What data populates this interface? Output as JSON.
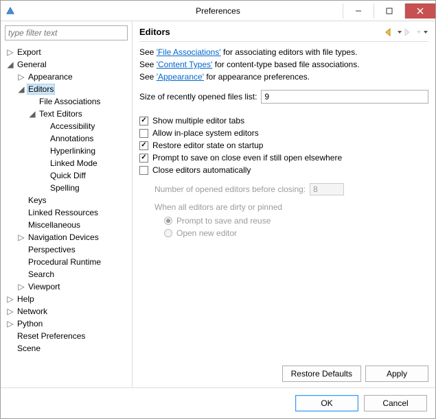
{
  "window": {
    "title": "Preferences"
  },
  "filter": {
    "placeholder": "type filter text"
  },
  "tree": {
    "export": "Export",
    "general": "General",
    "appearance": "Appearance",
    "editors": "Editors",
    "file_associations": "File Associations",
    "text_editors": "Text Editors",
    "accessibility": "Accessibility",
    "annotations": "Annotations",
    "hyperlinking": "Hyperlinking",
    "linked_mode": "Linked Mode",
    "quick_diff": "Quick Diff",
    "spelling": "Spelling",
    "keys": "Keys",
    "linked_ressources": "Linked Ressources",
    "miscellaneous": "Miscellaneous",
    "navigation_devices": "Navigation Devices",
    "perspectives": "Perspectives",
    "procedural_runtime": "Procedural Runtime",
    "search": "Search",
    "viewport": "Viewport",
    "help": "Help",
    "network": "Network",
    "python": "Python",
    "reset_preferences": "Reset Preferences",
    "scene": "Scene"
  },
  "page": {
    "title": "Editors",
    "line1_pre": "See ",
    "link1": "'File Associations'",
    "line1_post": " for associating editors with file types.",
    "line2_pre": "See ",
    "link2": "'Content Types'",
    "line2_post": " for content-type based file associations.",
    "line3_pre": "See ",
    "link3": "'Appearance'",
    "line3_post": " for appearance preferences.",
    "size_label": "Size of recently opened files list:",
    "size_value": "9",
    "chk1": "Show multiple editor tabs",
    "chk2": "Allow in-place system editors",
    "chk3": "Restore editor state on startup",
    "chk4": "Prompt to save on close even if still open elsewhere",
    "chk5": "Close editors automatically",
    "num_label": "Number of opened editors before closing:",
    "num_value": "8",
    "group_label": "When all editors are dirty or pinned",
    "radio1": "Prompt to save and reuse",
    "radio2": "Open new editor"
  },
  "buttons": {
    "restore": "Restore Defaults",
    "apply": "Apply",
    "ok": "OK",
    "cancel": "Cancel"
  }
}
